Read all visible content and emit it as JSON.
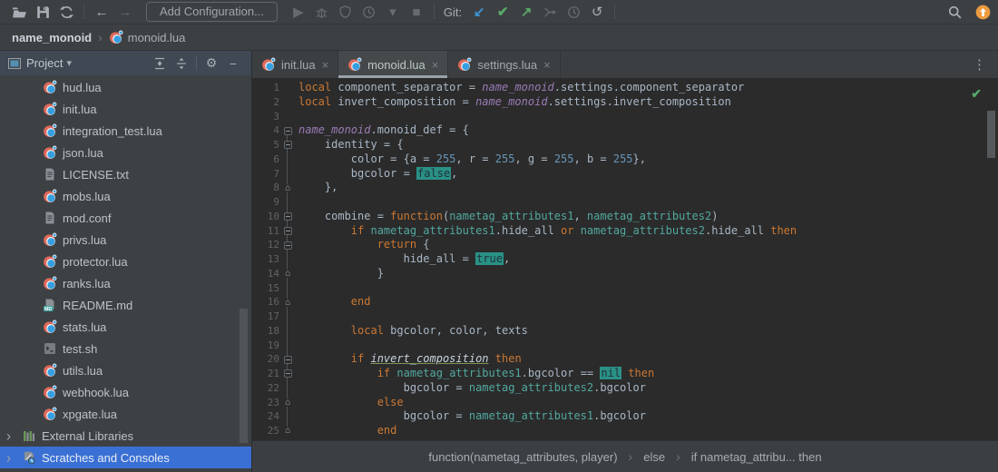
{
  "toolbar": {
    "file_icons": [
      "open",
      "save",
      "sync"
    ],
    "nav_icons": [
      "back",
      "forward"
    ],
    "add_configuration_label": "Add Configuration...",
    "run_icons": [
      "play",
      "bug",
      "coverage",
      "profiler",
      "caret",
      "stop"
    ],
    "git_label": "Git:",
    "git_icons": [
      "git-update",
      "git-commit",
      "git-push",
      "git-merge",
      "git-history",
      "git-rollback"
    ],
    "right_icons": [
      "search",
      "ide-update"
    ]
  },
  "window_crumbs": {
    "project": "name_monoid",
    "file": "monoid.lua",
    "file_icon": "lua"
  },
  "project_panel": {
    "title": "Project",
    "header_icons": [
      "expand-all",
      "collapse-all",
      "gear",
      "hide"
    ],
    "tree": [
      {
        "label": "hud.lua",
        "icon": "lua"
      },
      {
        "label": "init.lua",
        "icon": "lua"
      },
      {
        "label": "integration_test.lua",
        "icon": "lua"
      },
      {
        "label": "json.lua",
        "icon": "lua"
      },
      {
        "label": "LICENSE.txt",
        "icon": "text"
      },
      {
        "label": "mobs.lua",
        "icon": "lua"
      },
      {
        "label": "mod.conf",
        "icon": "text"
      },
      {
        "label": "privs.lua",
        "icon": "lua"
      },
      {
        "label": "protector.lua",
        "icon": "lua"
      },
      {
        "label": "ranks.lua",
        "icon": "lua"
      },
      {
        "label": "README.md",
        "icon": "md"
      },
      {
        "label": "stats.lua",
        "icon": "lua"
      },
      {
        "label": "test.sh",
        "icon": "shell"
      },
      {
        "label": "utils.lua",
        "icon": "lua"
      },
      {
        "label": "webhook.lua",
        "icon": "lua"
      },
      {
        "label": "xpgate.lua",
        "icon": "lua"
      },
      {
        "label": "External Libraries",
        "icon": "lib",
        "chevron": true,
        "root": true
      },
      {
        "label": "Scratches and Consoles",
        "icon": "scratch",
        "chevron": true,
        "root": true,
        "selected": true
      }
    ]
  },
  "tabs": [
    {
      "label": "init.lua",
      "icon": "lua",
      "active": false
    },
    {
      "label": "monoid.lua",
      "icon": "lua",
      "active": true
    },
    {
      "label": "settings.lua",
      "icon": "lua",
      "active": false
    }
  ],
  "editor": {
    "inspection_status": "ok",
    "lines": [
      {
        "n": 1,
        "fold": "",
        "segs": [
          [
            "k",
            "local"
          ],
          [
            "p",
            " component_separator = "
          ],
          [
            "g",
            "name_monoid"
          ],
          [
            "p",
            ".settings.component_separator"
          ]
        ]
      },
      {
        "n": 2,
        "fold": "",
        "segs": [
          [
            "k",
            "local"
          ],
          [
            "p",
            " invert_composition = "
          ],
          [
            "g",
            "name_monoid"
          ],
          [
            "p",
            ".settings.invert_composition"
          ]
        ]
      },
      {
        "n": 3,
        "fold": "",
        "segs": []
      },
      {
        "n": 4,
        "fold": "s",
        "segs": [
          [
            "g",
            "name_monoid"
          ],
          [
            "p",
            ".monoid_def = {"
          ]
        ]
      },
      {
        "n": 5,
        "fold": "s",
        "segs": [
          [
            "p",
            "    identity = {"
          ]
        ]
      },
      {
        "n": 6,
        "fold": "",
        "segs": [
          [
            "p",
            "        color = {a = "
          ],
          [
            "n",
            "255"
          ],
          [
            "p",
            ", r = "
          ],
          [
            "n",
            "255"
          ],
          [
            "p",
            ", g = "
          ],
          [
            "n",
            "255"
          ],
          [
            "p",
            ", b = "
          ],
          [
            "n",
            "255"
          ],
          [
            "p",
            "},"
          ]
        ]
      },
      {
        "n": 7,
        "fold": "",
        "segs": [
          [
            "p",
            "        bgcolor = "
          ],
          [
            "h",
            "false"
          ],
          [
            "p",
            ","
          ]
        ]
      },
      {
        "n": 8,
        "fold": "e",
        "segs": [
          [
            "p",
            "    },"
          ]
        ]
      },
      {
        "n": 9,
        "fold": "",
        "segs": []
      },
      {
        "n": 10,
        "fold": "s",
        "segs": [
          [
            "p",
            "    combine = "
          ],
          [
            "k",
            "function"
          ],
          [
            "p",
            "("
          ],
          [
            "a",
            "nametag_attributes1"
          ],
          [
            "p",
            ", "
          ],
          [
            "a",
            "nametag_attributes2"
          ],
          [
            "p",
            ")"
          ]
        ]
      },
      {
        "n": 11,
        "fold": "s",
        "segs": [
          [
            "p",
            "        "
          ],
          [
            "k",
            "if"
          ],
          [
            "p",
            " "
          ],
          [
            "a",
            "nametag_attributes1"
          ],
          [
            "p",
            ".hide_all "
          ],
          [
            "k",
            "or"
          ],
          [
            "p",
            " "
          ],
          [
            "a",
            "nametag_attributes2"
          ],
          [
            "p",
            ".hide_all "
          ],
          [
            "k",
            "then"
          ]
        ]
      },
      {
        "n": 12,
        "fold": "s",
        "segs": [
          [
            "p",
            "            "
          ],
          [
            "k",
            "return"
          ],
          [
            "p",
            " {"
          ]
        ]
      },
      {
        "n": 13,
        "fold": "",
        "segs": [
          [
            "p",
            "                hide_all = "
          ],
          [
            "h",
            "true"
          ],
          [
            "p",
            ","
          ]
        ]
      },
      {
        "n": 14,
        "fold": "e",
        "segs": [
          [
            "p",
            "            }"
          ]
        ]
      },
      {
        "n": 15,
        "fold": "",
        "segs": []
      },
      {
        "n": 16,
        "fold": "e",
        "segs": [
          [
            "p",
            "        "
          ],
          [
            "k",
            "end"
          ]
        ]
      },
      {
        "n": 17,
        "fold": "",
        "segs": []
      },
      {
        "n": 18,
        "fold": "",
        "segs": [
          [
            "p",
            "        "
          ],
          [
            "k",
            "local"
          ],
          [
            "p",
            " bgcolor, color, texts"
          ]
        ]
      },
      {
        "n": 19,
        "fold": "",
        "segs": []
      },
      {
        "n": 20,
        "fold": "s",
        "segs": [
          [
            "p",
            "        "
          ],
          [
            "k",
            "if"
          ],
          [
            "p",
            " "
          ],
          [
            "u",
            "invert_composition"
          ],
          [
            "p",
            " "
          ],
          [
            "k",
            "then"
          ]
        ]
      },
      {
        "n": 21,
        "fold": "s",
        "segs": [
          [
            "p",
            "            "
          ],
          [
            "k",
            "if"
          ],
          [
            "p",
            " "
          ],
          [
            "a",
            "nametag_attributes1"
          ],
          [
            "p",
            ".bgcolor == "
          ],
          [
            "h",
            "nil"
          ],
          [
            "p",
            " "
          ],
          [
            "k",
            "then"
          ]
        ]
      },
      {
        "n": 22,
        "fold": "",
        "segs": [
          [
            "p",
            "                bgcolor = "
          ],
          [
            "a",
            "nametag_attributes2"
          ],
          [
            "p",
            ".bgcolor"
          ]
        ]
      },
      {
        "n": 23,
        "fold": "e",
        "segs": [
          [
            "p",
            "            "
          ],
          [
            "k",
            "else"
          ]
        ]
      },
      {
        "n": 24,
        "fold": "",
        "segs": [
          [
            "p",
            "                bgcolor = "
          ],
          [
            "a",
            "nametag_attributes1"
          ],
          [
            "p",
            ".bgcolor"
          ]
        ]
      },
      {
        "n": 25,
        "fold": "e",
        "segs": [
          [
            "p",
            "            "
          ],
          [
            "k",
            "end"
          ]
        ]
      }
    ]
  },
  "status_bar": {
    "crumbs": [
      "function(nametag_attributes, player)",
      "else",
      "if nametag_attribu... then"
    ]
  },
  "colors": {
    "selection_blue": "#3a70d4",
    "keyword_orange": "#cc7832",
    "number_blue": "#6897bb",
    "plain_text": "#a9b7c6",
    "global_purple": "#9a7bb5",
    "param_teal": "#52a8a0",
    "highlight_teal_bg": "#2a9187",
    "line_number_gray": "#606366",
    "git_green": "#59a869",
    "git_blue": "#3d94d6",
    "update_orange": "#ec9b3f",
    "check_green": "#59a869"
  }
}
